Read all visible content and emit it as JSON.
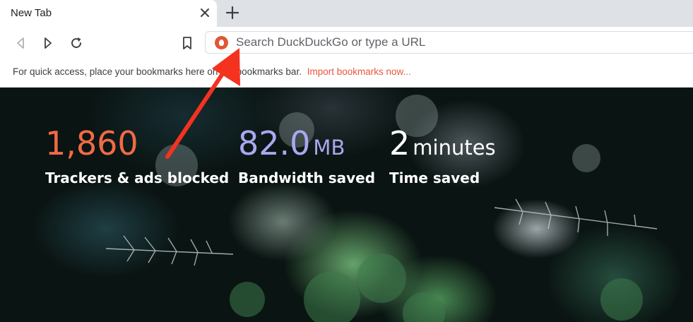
{
  "tab": {
    "title": "New Tab"
  },
  "toolbar": {
    "back_icon": "back-icon",
    "forward_icon": "forward-icon",
    "reload_icon": "reload-icon",
    "bookmark_icon": "bookmark-icon"
  },
  "omnibox": {
    "placeholder": "Search DuckDuckGo or type a URL",
    "logo_icon": "duckduckgo-icon"
  },
  "bookmarks_bar": {
    "message": "For quick access, place your bookmarks here on the bookmarks bar.",
    "import_link": "Import bookmarks now..."
  },
  "stats": [
    {
      "value": "1,860",
      "unit": "",
      "label": "Trackers & ads blocked",
      "color": "#f26a45"
    },
    {
      "value": "82.0",
      "unit": "MB",
      "label": "Bandwidth saved",
      "color": "#a9a8f0"
    },
    {
      "value": "2",
      "unit": "minutes",
      "label": "Time saved",
      "color": "#ffffff"
    }
  ],
  "colors": {
    "annotation_arrow": "#f4321f",
    "link": "#e8573a"
  }
}
